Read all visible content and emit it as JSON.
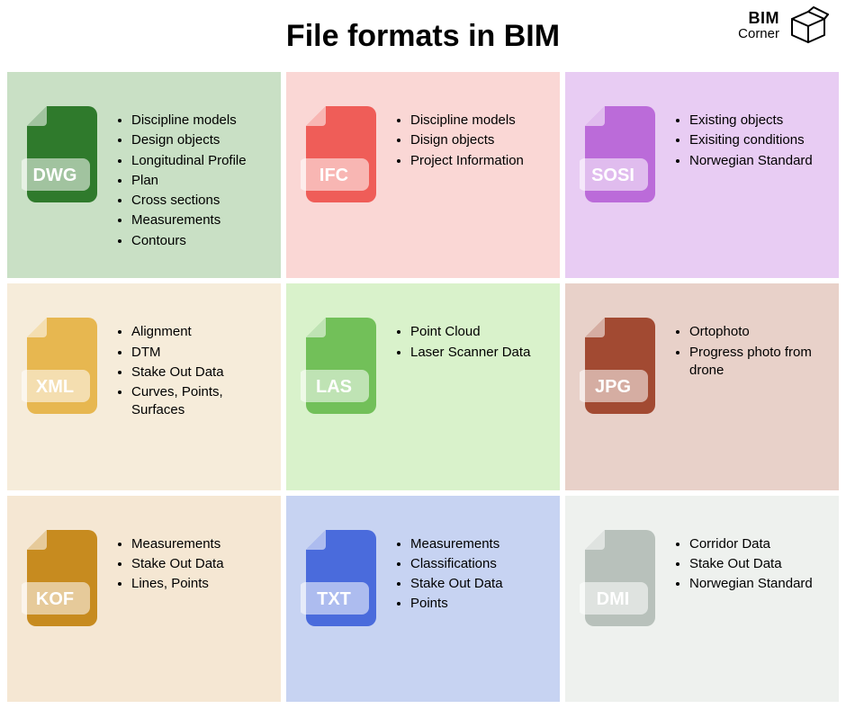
{
  "title": "File formats in BIM",
  "brand": {
    "line1": "BIM",
    "line2": "Corner"
  },
  "cards": [
    {
      "id": "dwg",
      "label": "DWG",
      "bg": "bg-dwg",
      "icon": "#2f7a2c",
      "items": [
        "Discipline models",
        "Design objects",
        "Longitudinal Profile",
        "Plan",
        "Cross sections",
        "Measurements",
        "Contours"
      ]
    },
    {
      "id": "ifc",
      "label": "IFC",
      "bg": "bg-ifc",
      "icon": "#ef5d58",
      "items": [
        "Discipline models",
        "Disign objects",
        "Project Information"
      ]
    },
    {
      "id": "sosi",
      "label": "SOSI",
      "bg": "bg-sosi",
      "icon": "#bb6bd9",
      "items": [
        "Existing objects",
        "Exisiting conditions",
        "Norwegian Standard"
      ]
    },
    {
      "id": "xml",
      "label": "XML",
      "bg": "bg-xml",
      "icon": "#e7b750",
      "items": [
        "Alignment",
        "DTM",
        "Stake Out Data",
        "Curves, Points, Surfaces"
      ]
    },
    {
      "id": "las",
      "label": "LAS",
      "bg": "bg-las",
      "icon": "#72c059",
      "items": [
        "Point Cloud",
        "Laser Scanner Data"
      ]
    },
    {
      "id": "jpg",
      "label": "JPG",
      "bg": "bg-jpg",
      "icon": "#a24a32",
      "items": [
        "Ortophoto",
        "Progress photo from drone"
      ]
    },
    {
      "id": "kof",
      "label": "KOF",
      "bg": "bg-kof",
      "icon": "#c78b1f",
      "items": [
        "Measurements",
        "Stake Out Data",
        "Lines, Points"
      ]
    },
    {
      "id": "txt",
      "label": "TXT",
      "bg": "bg-txt",
      "icon": "#4a6bdc",
      "items": [
        "Measurements",
        "Classifications",
        "Stake Out Data",
        "Points"
      ]
    },
    {
      "id": "dmi",
      "label": "DMI",
      "bg": "bg-dmi",
      "icon": "#b8c1bb",
      "items": [
        "Corridor Data",
        "Stake Out Data",
        "Norwegian Standard"
      ]
    }
  ]
}
